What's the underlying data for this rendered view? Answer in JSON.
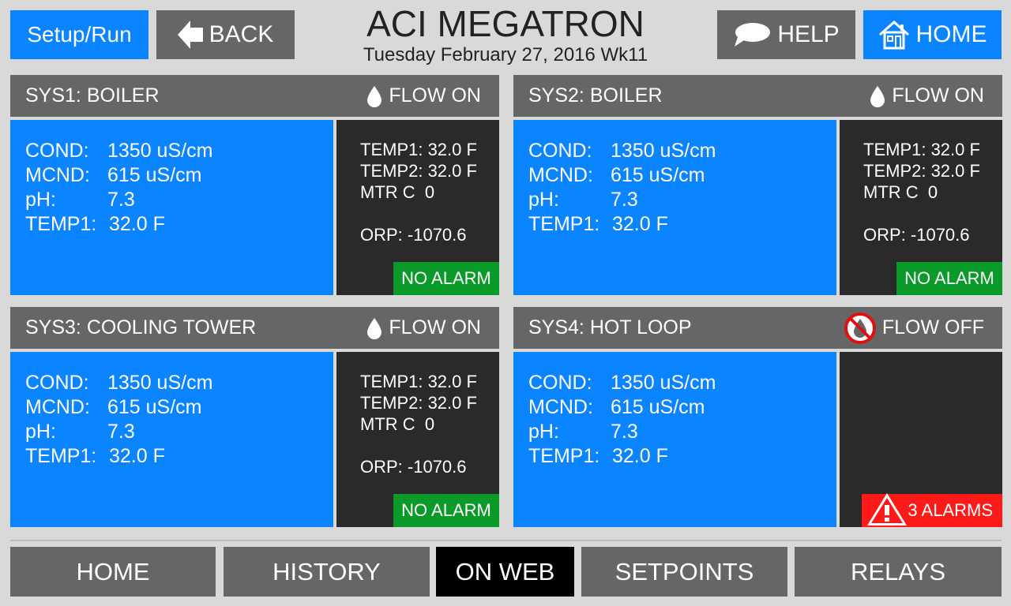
{
  "header": {
    "setup_label": "Setup/Run",
    "back_label": "BACK",
    "title": "ACI MEGATRON",
    "date": "Tuesday February 27, 2016 Wk11",
    "help_label": "HELP",
    "home_label": "HOME"
  },
  "systems": [
    {
      "name": "SYS1: BOILER",
      "flow": "FLOW ON",
      "cond_label": "COND:",
      "cond": "1350 uS/cm",
      "mcnd_label": "MCND:",
      "mcnd": "615 uS/cm",
      "ph_label": "pH:",
      "ph": "7.3",
      "temp_label": "TEMP1:",
      "temp": "32.0 F",
      "side_temp1": "TEMP1: 32.0 F",
      "side_temp2": "TEMP2: 32.0 F",
      "side_mtr": "MTR C  0",
      "side_orp": "ORP: -1070.6",
      "alarm": "NO ALARM"
    },
    {
      "name": "SYS2: BOILER",
      "flow": "FLOW ON",
      "cond_label": "COND:",
      "cond": "1350 uS/cm",
      "mcnd_label": "MCND:",
      "mcnd": "615 uS/cm",
      "ph_label": "pH:",
      "ph": "7.3",
      "temp_label": "TEMP1:",
      "temp": "32.0 F",
      "side_temp1": "TEMP1: 32.0 F",
      "side_temp2": "TEMP2: 32.0 F",
      "side_mtr": "MTR C  0",
      "side_orp": "ORP: -1070.6",
      "alarm": "NO ALARM"
    },
    {
      "name": "SYS3: COOLING TOWER",
      "flow": "FLOW ON",
      "cond_label": "COND:",
      "cond": "1350 uS/cm",
      "mcnd_label": "MCND:",
      "mcnd": "615 uS/cm",
      "ph_label": "pH:",
      "ph": "7.3",
      "temp_label": "TEMP1:",
      "temp": "32.0 F",
      "side_temp1": "TEMP1: 32.0 F",
      "side_temp2": "TEMP2: 32.0 F",
      "side_mtr": "MTR C  0",
      "side_orp": "ORP: -1070.6",
      "alarm": "NO ALARM"
    },
    {
      "name": "SYS4: HOT LOOP",
      "flow": "FLOW OFF",
      "cond_label": "COND:",
      "cond": "1350 uS/cm",
      "mcnd_label": "MCND:",
      "mcnd": "615 uS/cm",
      "ph_label": "pH:",
      "ph": "7.3",
      "temp_label": "TEMP1:",
      "temp": "32.0 F",
      "alarm": "3 ALARMS"
    }
  ],
  "nav": {
    "home": "HOME",
    "history": "HISTORY",
    "on_web": "ON WEB",
    "setpoints": "SETPOINTS",
    "relays": "RELAYS"
  },
  "colors": {
    "accent_blue": "#0a84ff",
    "header_gray": "#666666",
    "side_dark": "#2a2a2a",
    "ok_green": "#0a9a2a",
    "alarm_red": "#ff1a1a",
    "active_tab": "#000000"
  },
  "icons": {
    "back": "back-arrow-icon",
    "help": "speech-bubble-icon",
    "home": "house-icon",
    "flow_on": "water-drop-icon",
    "flow_off": "no-flow-icon",
    "alarm": "warning-triangle-icon"
  }
}
